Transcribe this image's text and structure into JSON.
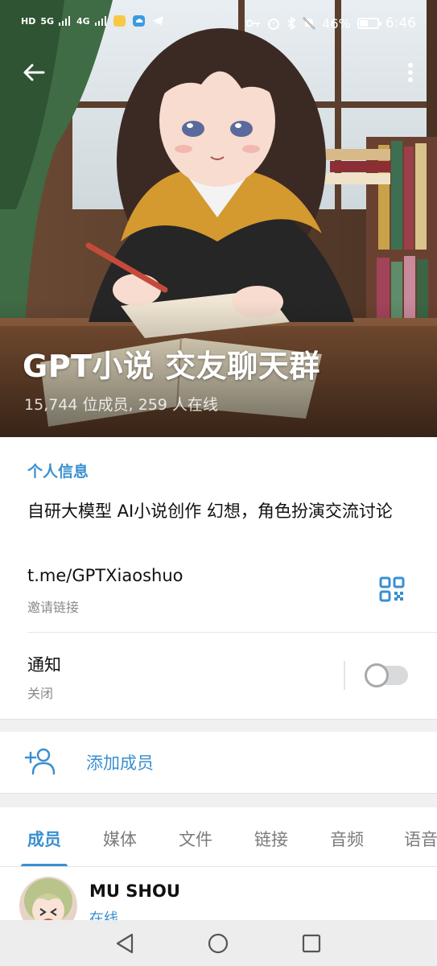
{
  "status_bar": {
    "network_labels": [
      "HD",
      "5G",
      "4G"
    ],
    "battery_percent": "46%",
    "battery_level": 0.46,
    "time": "6:46"
  },
  "header": {
    "group_name": "GPT小说 交友聊天群",
    "subtitle": "15,744 位成员, 259 人在线"
  },
  "info": {
    "section_title": "个人信息",
    "bio": "自研大模型 AI小说创作 幻想，角色扮演交流讨论",
    "invite_link": "t.me/GPTXiaoshuo",
    "invite_label": "邀请链接",
    "notifications_label": "通知",
    "notifications_status": "关闭",
    "notifications_enabled": false
  },
  "actions": {
    "add_member_label": "添加成员"
  },
  "tabs": [
    {
      "label": "成员",
      "active": true
    },
    {
      "label": "媒体",
      "active": false
    },
    {
      "label": "文件",
      "active": false
    },
    {
      "label": "链接",
      "active": false
    },
    {
      "label": "音频",
      "active": false
    },
    {
      "label": "语音",
      "active": false
    }
  ],
  "members": [
    {
      "name": "MU SHOU",
      "status": "在线"
    }
  ],
  "colors": {
    "accent": "#3a8fd0",
    "text_primary": "#111111",
    "text_secondary": "#8a8a8a"
  },
  "icons": {
    "back": "arrow-left-icon",
    "more": "more-vertical-icon",
    "qr": "qr-code-icon",
    "add_member": "add-person-icon",
    "nav": [
      "back-triangle-icon",
      "home-circle-icon",
      "recents-square-icon"
    ]
  }
}
